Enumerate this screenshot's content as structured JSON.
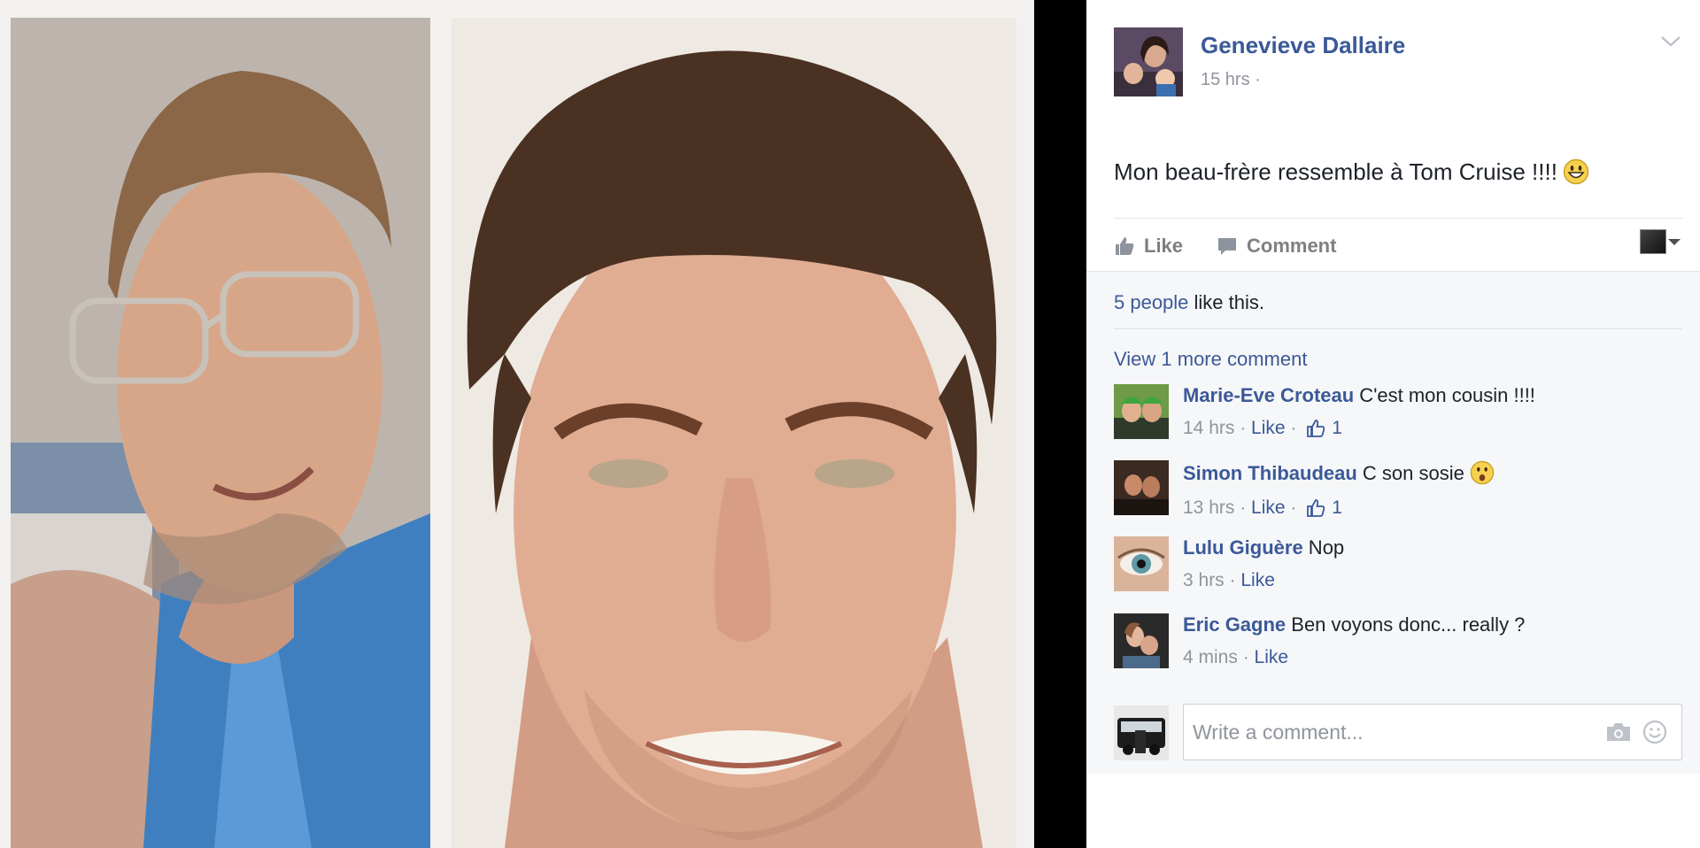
{
  "post": {
    "author": "Genevieve Dallaire",
    "time": "15 hrs ·",
    "text": "Mon beau-frère ressemble à Tom Cruise !!!!",
    "actions": {
      "like": "Like",
      "comment": "Comment"
    },
    "likes": {
      "count_text": "5 people",
      "suffix": " like this."
    },
    "view_more": "View 1 more comment",
    "comments": [
      {
        "name": "Marie-Eve Croteau",
        "text": " C'est mon cousin !!!!",
        "time": "14 hrs",
        "like": "Like",
        "likes": "1"
      },
      {
        "name": "Simon Thibaudeau",
        "text": " C son sosie",
        "time": "13 hrs",
        "like": "Like",
        "likes": "1"
      },
      {
        "name": "Lulu Giguère",
        "text": " Nop",
        "time": "3 hrs",
        "like": "Like"
      },
      {
        "name": "Eric Gagne",
        "text": " Ben voyons donc... really ?",
        "time": "4 mins",
        "like": "Like"
      }
    ],
    "compose": {
      "placeholder": "Write a comment..."
    }
  },
  "icons": {
    "chevron": "chevron-down-icon",
    "like": "thumbs-up-icon",
    "comment": "speech-bubble-icon",
    "camera": "camera-icon",
    "smiley": "smiley-icon"
  },
  "colors": {
    "link": "#3b5998",
    "meta": "#90949c",
    "feedback_bg": "#f6f7f9"
  }
}
